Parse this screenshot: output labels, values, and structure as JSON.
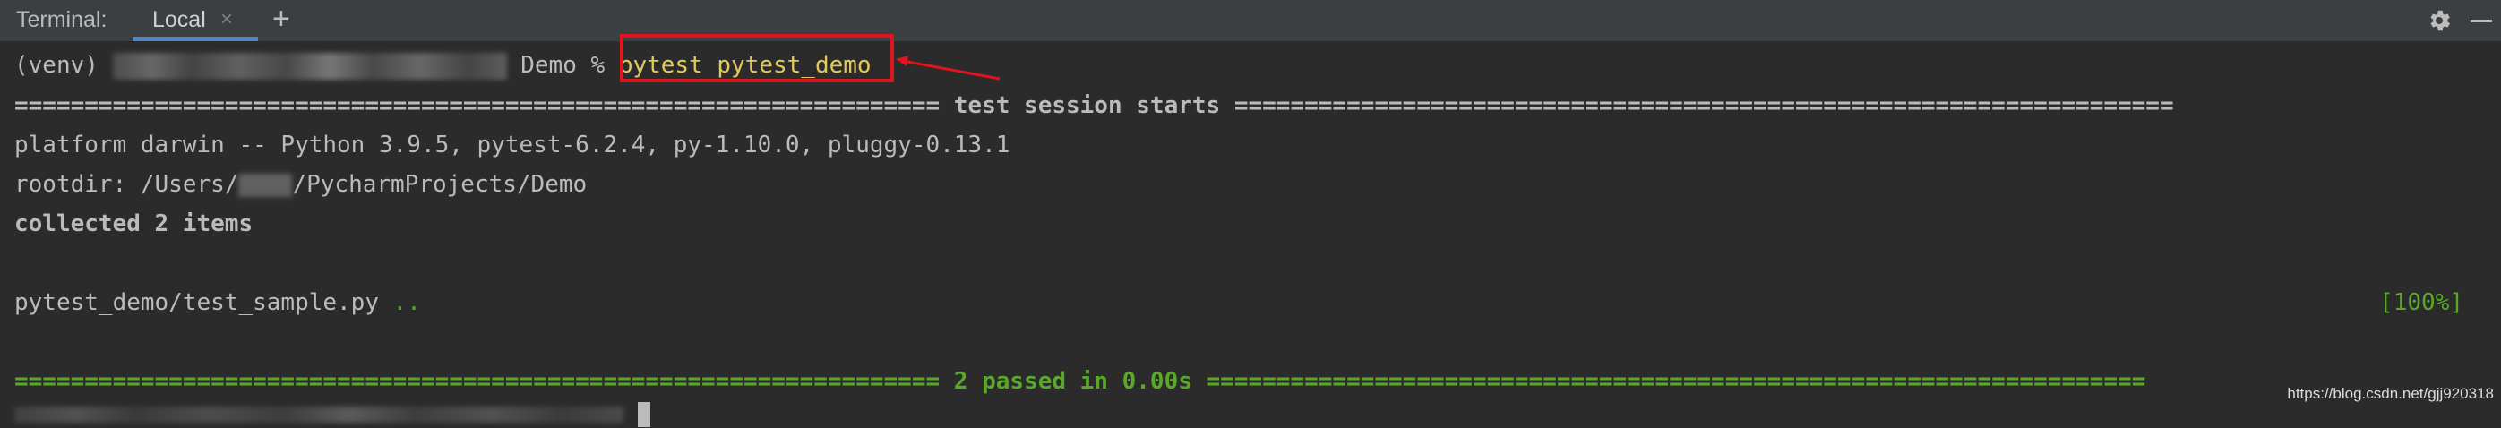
{
  "tabbar": {
    "terminal_label": "Terminal:",
    "tab_label": "Local",
    "close_glyph": "×",
    "add_glyph": "+",
    "settings_icon": "gear-icon",
    "minimize_icon": "minimize-icon"
  },
  "terminal": {
    "prompt_prefix": "(venv) ",
    "prompt_suffix": " Demo % ",
    "command": "pytest pytest_demo",
    "session_line": "================================================================== test session starts ===================================================================",
    "platform_line": "platform darwin -- Python 3.9.5, pytest-6.2.4, py-1.10.0, pluggy-0.13.1",
    "rootdir_prefix": "rootdir: /Users/",
    "rootdir_suffix": "/PycharmProjects/Demo",
    "collected_line": "collected 2 items",
    "test_file": "pytest_demo/test_sample.py ",
    "test_dots": "..",
    "test_percent": "[100%]",
    "passed_line": "================================================================== 2 passed in 0.00s ==================================================================="
  },
  "colors": {
    "background": "#2b2b2b",
    "tabbar_bg": "#3c3f41",
    "accent_blue": "#4a88c7",
    "pass_green": "#59a827",
    "command_yellow": "#e2c95a",
    "annotation_red": "#e0141e"
  },
  "watermark": "https://blog.csdn.net/gjj920318"
}
